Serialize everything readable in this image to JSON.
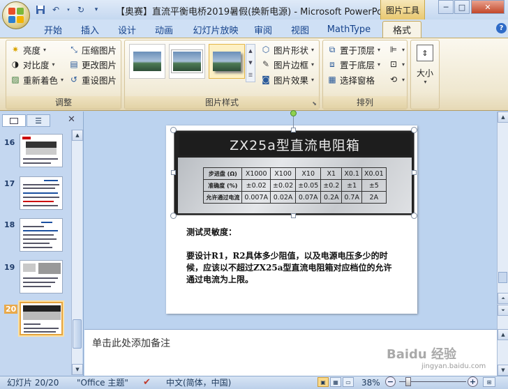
{
  "window": {
    "title": "【奥赛】直流平衡电桥2019暑假(换新电源) - Microsoft PowerPo...",
    "context_tab": "图片工具",
    "controls": {
      "minimize": "─",
      "maximize": "□",
      "close": "✕"
    }
  },
  "quick_access": {
    "save_icon": "save-icon",
    "undo_icon": "undo-icon",
    "redo_icon": "redo-icon",
    "customize_icon": "customize-icon"
  },
  "ribbon_tabs": [
    "开始",
    "插入",
    "设计",
    "动画",
    "幻灯片放映",
    "审阅",
    "视图",
    "MathType",
    "格式"
  ],
  "active_tab": "格式",
  "groups": {
    "adjust": {
      "label": "调整",
      "buttons": [
        "亮度",
        "对比度",
        "重新着色",
        "压缩图片",
        "更改图片",
        "重设图片"
      ]
    },
    "picture_styles": {
      "label": "图片样式",
      "buttons": [
        "图片形状",
        "图片边框",
        "图片效果"
      ]
    },
    "arrange": {
      "label": "排列",
      "buttons": [
        "置于顶层",
        "置于底层",
        "选择窗格"
      ]
    },
    "size": {
      "label": "大小"
    }
  },
  "outline_pane": {
    "tabs": [
      "slides-tab",
      "outline-tab"
    ],
    "close": "✕",
    "slides": [
      {
        "number": "16"
      },
      {
        "number": "17"
      },
      {
        "number": "18"
      },
      {
        "number": "19"
      },
      {
        "number": "20",
        "selected": true
      }
    ]
  },
  "slide": {
    "plate_title": "ZX25a型直流电阻箱",
    "spec_table": {
      "rows": [
        [
          "步进盘 (Ω)",
          "X1000",
          "X100",
          "X10",
          "X1",
          "X0.1",
          "X0.01"
        ],
        [
          "准确度 (%)",
          "±0.02",
          "±0.02",
          "±0.05",
          "±0.2",
          "±1",
          "±5"
        ],
        [
          "允许通过电流",
          "0.007A",
          "0.02A",
          "0.07A",
          "0.2A",
          "0.7A",
          "2A"
        ]
      ]
    },
    "heading": "测试灵敏度：",
    "body": "要设计R1，R2具体多少阻值，以及电源电压多少的时候，应该以不超过ZX25a型直流电阻箱对应档位的允许通过电流为上限。"
  },
  "notes": {
    "placeholder": "单击此处添加备注"
  },
  "status_bar": {
    "slide_info": "幻灯片 20/20",
    "theme": "\"Office 主题\"",
    "language": "中文(简体，中国)",
    "zoom": "38%"
  },
  "watermark": {
    "text": "Baidu 经验",
    "sub": "jingyan.baidu.com"
  },
  "colors": {
    "accent": "#c6a85b",
    "ribbon_bg": "#f7f3e6",
    "frame": "#bcd3ef"
  }
}
